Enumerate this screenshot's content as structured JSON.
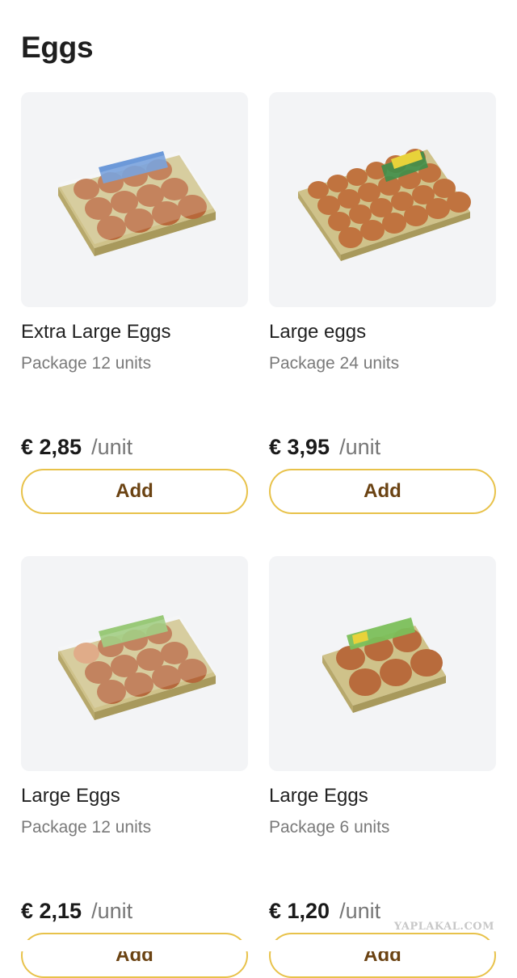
{
  "page": {
    "title": "Eggs"
  },
  "products": [
    {
      "name": "Extra Large Eggs",
      "package": "Package 12 units",
      "price": "€ 2,85",
      "unit": "/unit",
      "add_label": "Add",
      "image": "egg-carton-12-icon"
    },
    {
      "name": "Large eggs",
      "package": "Package 24 units",
      "price": "€ 3,95",
      "unit": "/unit",
      "add_label": "Add",
      "image": "egg-carton-24-icon"
    },
    {
      "name": "Large Eggs",
      "package": "Package 12 units",
      "price": "€ 2,15",
      "unit": "/unit",
      "add_label": "Add",
      "image": "egg-carton-12-icon"
    },
    {
      "name": "Large Eggs",
      "package": "Package 6 units",
      "price": "€ 1,20",
      "unit": "/unit",
      "add_label": "Add",
      "image": "egg-carton-6-icon"
    }
  ],
  "watermark": "YAPLAKAL.COM",
  "colors": {
    "accent_border": "#e8c24a",
    "button_text": "#6b4313",
    "image_bg": "#f3f4f6"
  }
}
